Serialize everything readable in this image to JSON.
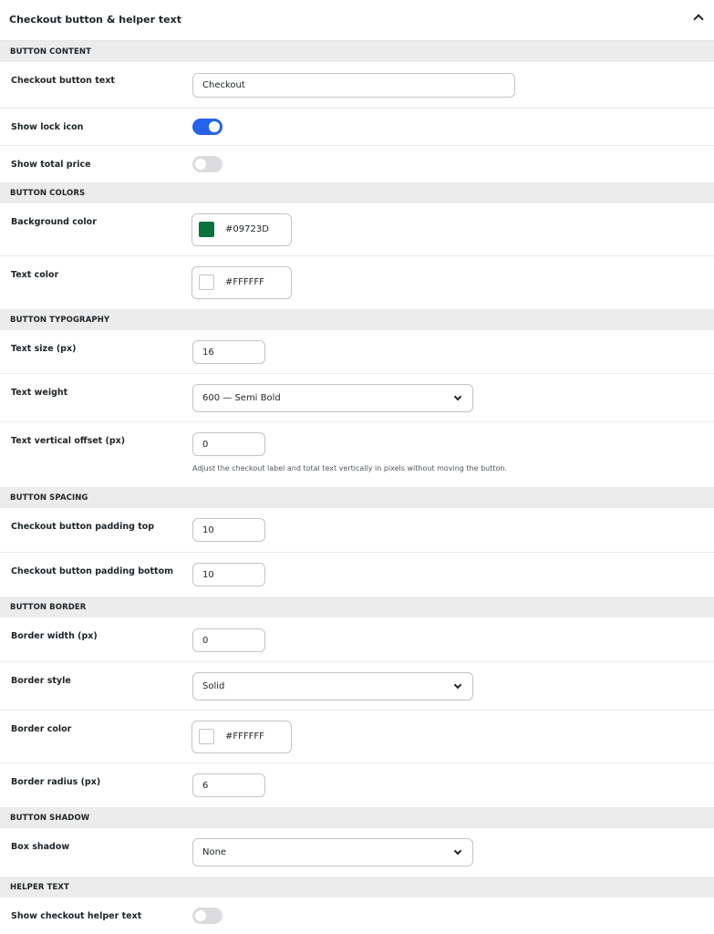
{
  "panel": {
    "title": "Checkout button & helper text"
  },
  "content": {
    "heading": "BUTTON CONTENT",
    "checkout_text": {
      "label": "Checkout button text",
      "value": "Checkout"
    },
    "lock_icon": {
      "label": "Show lock icon",
      "state": "on"
    },
    "total_price": {
      "label": "Show total price",
      "state": "off"
    }
  },
  "colors": {
    "heading": "BUTTON COLORS",
    "background": {
      "label": "Background color",
      "value": "#09723D",
      "swatch": "#09723D"
    },
    "text": {
      "label": "Text color",
      "value": "#FFFFFF",
      "swatch": "#FFFFFF"
    }
  },
  "typography": {
    "heading": "BUTTON TYPOGRAPHY",
    "size": {
      "label": "Text size (px)",
      "value": "16"
    },
    "weight": {
      "label": "Text weight",
      "value": "600 — Semi Bold"
    },
    "offset": {
      "label": "Text vertical offset (px)",
      "value": "0",
      "help": "Adjust the checkout label and total text vertically in pixels without moving the button."
    }
  },
  "spacing": {
    "heading": "BUTTON SPACING",
    "padding_top": {
      "label": "Checkout button padding top",
      "value": "10"
    },
    "padding_bottom": {
      "label": "Checkout button padding bottom",
      "value": "10"
    }
  },
  "border": {
    "heading": "BUTTON BORDER",
    "width": {
      "label": "Border width (px)",
      "value": "0"
    },
    "style": {
      "label": "Border style",
      "value": "Solid"
    },
    "color": {
      "label": "Border color",
      "value": "#FFFFFF",
      "swatch": "#FFFFFF"
    },
    "radius": {
      "label": "Border radius (px)",
      "value": "6"
    }
  },
  "shadow": {
    "heading": "BUTTON SHADOW",
    "box": {
      "label": "Box shadow",
      "value": "None"
    }
  },
  "helper": {
    "heading": "HELPER TEXT",
    "show": {
      "label": "Show checkout helper text",
      "state": "off"
    }
  },
  "theme": {
    "accent": "#2563eb",
    "section_bg": "#ececec"
  }
}
